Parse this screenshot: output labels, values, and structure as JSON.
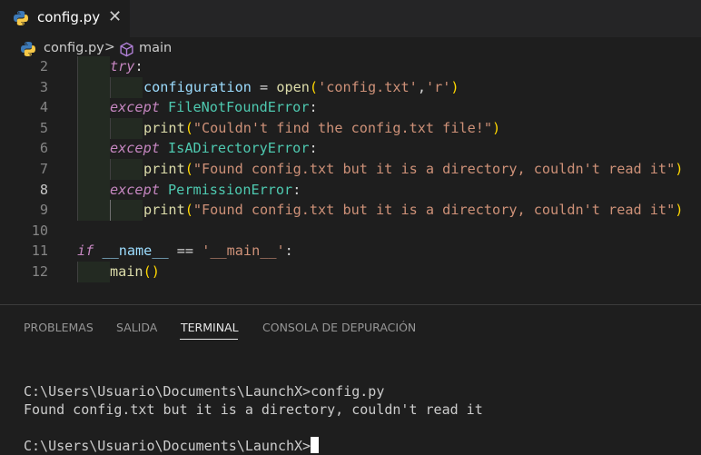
{
  "tab": {
    "label": "config.py",
    "close": "✕",
    "icon": "python-file-icon"
  },
  "breadcrumb": {
    "file": "config.py",
    "separator": ">",
    "symbol": "main",
    "symbol_icon": "symbol-method-icon"
  },
  "editor": {
    "active_line": 8,
    "lines": [
      {
        "n": "2",
        "text": "try:"
      },
      {
        "n": "3",
        "text": "configuration = open('config.txt','r')"
      },
      {
        "n": "4",
        "text": "except FileNotFoundError:"
      },
      {
        "n": "5",
        "text": "print(\"Couldn't find the config.txt file!\")"
      },
      {
        "n": "6",
        "text": "except IsADirectoryError:"
      },
      {
        "n": "7",
        "text": "print(\"Found config.txt but it is a directory, couldn't read it\")"
      },
      {
        "n": "8",
        "text": "except PermissionError:"
      },
      {
        "n": "9",
        "text": "print(\"Found config.txt but it is a directory, couldn't read it\")"
      },
      {
        "n": "10",
        "text": ""
      },
      {
        "n": "11",
        "text": "if __name__ == '__main__':"
      },
      {
        "n": "12",
        "text": "main()"
      }
    ]
  },
  "panel": {
    "tabs": [
      "PROBLEMAS",
      "SALIDA",
      "TERMINAL",
      "CONSOLA DE DEPURACIÓN"
    ],
    "active_tab": "TERMINAL"
  },
  "terminal": {
    "lines": [
      "C:\\Users\\Usuario\\Documents\\LaunchX>config.py",
      "Found config.txt but it is a directory, couldn't read it",
      "",
      "C:\\Users\\Usuario\\Documents\\LaunchX>"
    ]
  },
  "colors": {
    "background": "#1e1e1e",
    "keyword_control": "#c586c0",
    "function": "#dcdcaa",
    "class": "#4ec9b0",
    "variable": "#9cdcfe",
    "string": "#ce9178",
    "keyword": "#569cd6",
    "bracket": "#ffd700"
  }
}
